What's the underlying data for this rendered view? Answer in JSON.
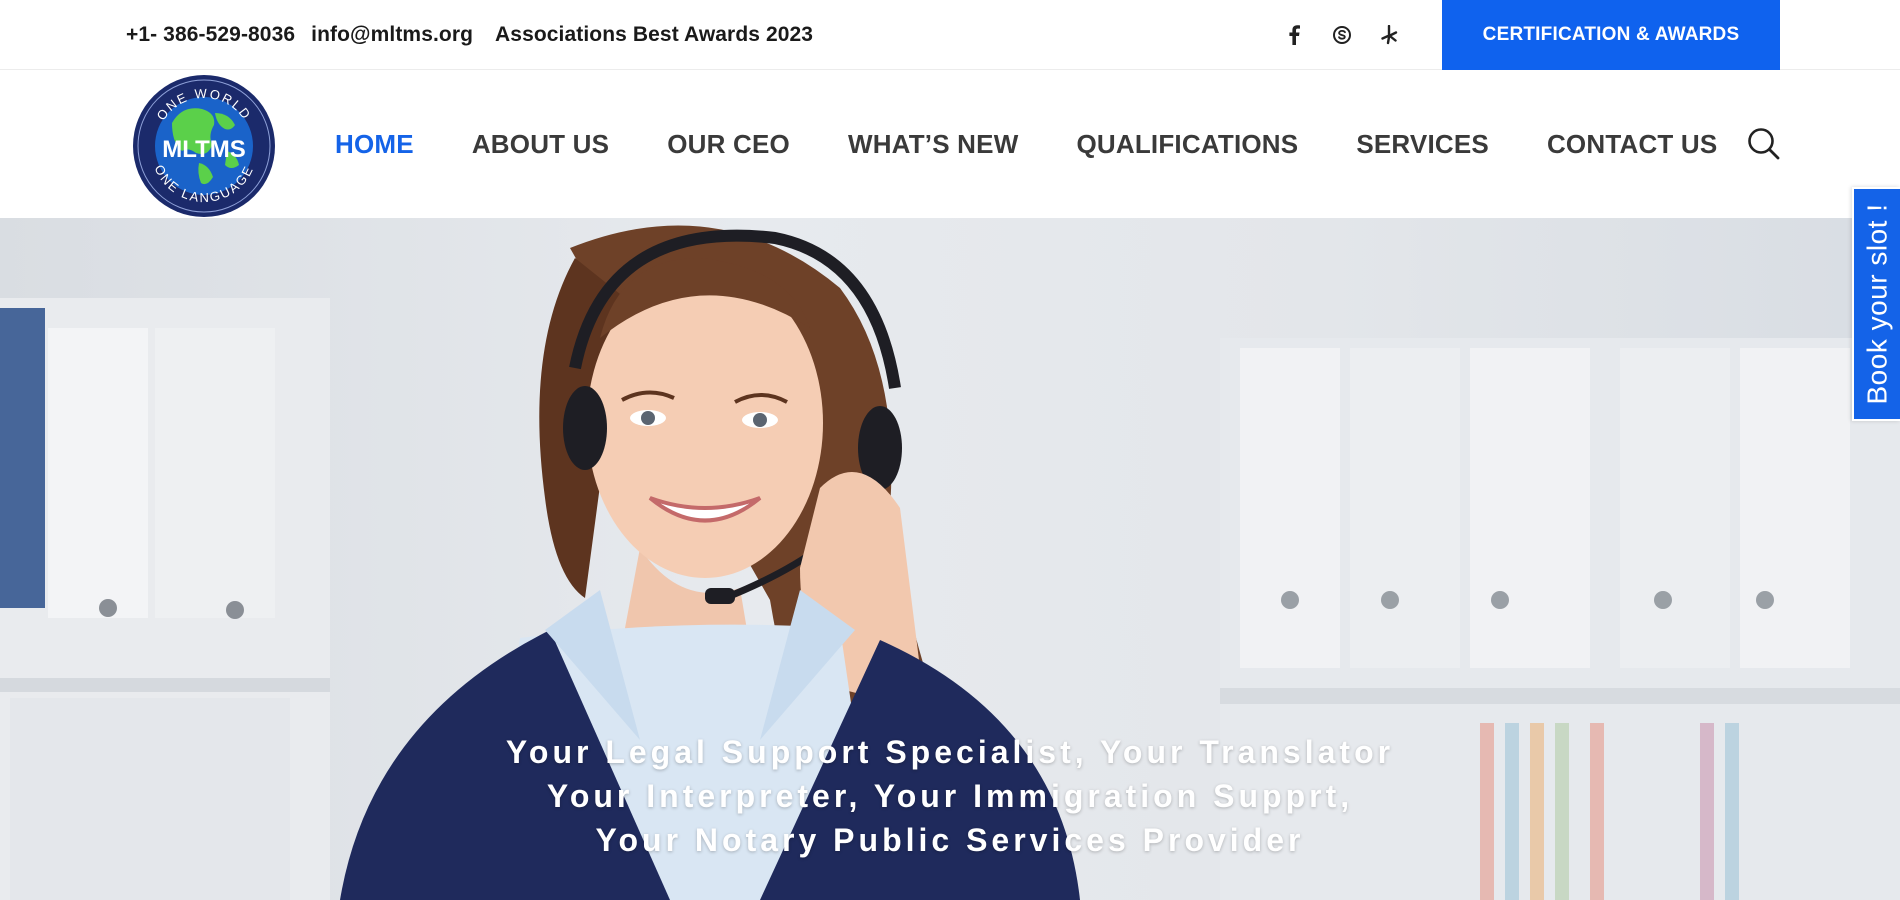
{
  "topbar": {
    "phone": "+1- 386-529-8036",
    "email": "info@mltms.org",
    "award": "Associations Best Awards 2023",
    "social_icons": [
      "facebook-icon",
      "skype-icon",
      "yelp-icon"
    ],
    "cta_label": "CERTIFICATION & AWARDS"
  },
  "logo": {
    "top_text": "ONE WORLD",
    "name": "MLTMS",
    "bottom_text": "ONE LANGUAGE"
  },
  "nav": {
    "items": [
      "HOME",
      "ABOUT US",
      "OUR CEO",
      "WHAT’S NEW",
      "QUALIFICATIONS",
      "SERVICES",
      "CONTACT US"
    ],
    "active": "HOME",
    "search_icon": "search-icon"
  },
  "hero": {
    "lines": [
      "Your Legal Support Specialist, Your Translator",
      "Your Interpreter, Your Immigration Supprt,",
      "Your Notary Public Services Provider"
    ]
  },
  "book_tab": {
    "label": "Book your slot !"
  },
  "colors": {
    "accent": "#1463e8",
    "cta": "#0f62ee",
    "navy": "#1e2f6e",
    "text": "#3a3a3a"
  }
}
